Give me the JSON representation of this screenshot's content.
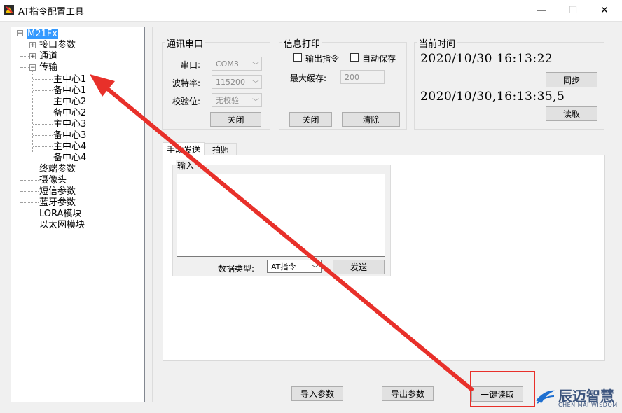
{
  "window": {
    "title": "AT指令配置工具",
    "minimize": "—",
    "maximize": "☐",
    "close": "✕"
  },
  "tree": {
    "root": "M21Fx",
    "items": [
      {
        "label": "接口参数",
        "expander": "+"
      },
      {
        "label": "通道",
        "expander": "+"
      },
      {
        "label": "传输",
        "expander": "−"
      },
      {
        "label": "主中心1"
      },
      {
        "label": "备中心1"
      },
      {
        "label": "主中心2"
      },
      {
        "label": "备中心2"
      },
      {
        "label": "主中心3"
      },
      {
        "label": "备中心3"
      },
      {
        "label": "主中心4"
      },
      {
        "label": "备中心4"
      },
      {
        "label": "终端参数"
      },
      {
        "label": "摄像头"
      },
      {
        "label": "短信参数"
      },
      {
        "label": "蓝牙参数"
      },
      {
        "label": "LORA模块"
      },
      {
        "label": "以太网模块"
      }
    ],
    "root_expander": "−"
  },
  "serial": {
    "title": "通讯串口",
    "port_label": "串口:",
    "port_value": "COM3",
    "baud_label": "波特率:",
    "baud_value": "115200",
    "parity_label": "校验位:",
    "parity_value": "无校验",
    "close_button": "关闭"
  },
  "info": {
    "title": "信息打印",
    "output_cmd": "输出指令",
    "auto_save": "自动保存",
    "max_cache_label": "最大缓存:",
    "max_cache_value": "200",
    "close_button": "关闭",
    "clear_button": "清除"
  },
  "time": {
    "title": "当前时间",
    "pc_time": "2020/10/30  16:13:22",
    "sync_button": "同步",
    "device_time": "2020/10/30,16:13:35,5",
    "read_button": "读取"
  },
  "tabs": {
    "manual": "手动发送",
    "photo": "拍照"
  },
  "send": {
    "input_title": "输入",
    "data_type_label": "数据类型:",
    "data_type_value": "AT指令",
    "send_button": "发送"
  },
  "bottom": {
    "import_button": "导入参数",
    "export_button": "导出参数",
    "read_all_button": "一键读取"
  },
  "logo": {
    "cn": "辰迈智慧",
    "en": "CHEN MAI WISDOM"
  },
  "colors": {
    "annotation_red": "#e8302a",
    "selection_blue": "#3399ff"
  }
}
